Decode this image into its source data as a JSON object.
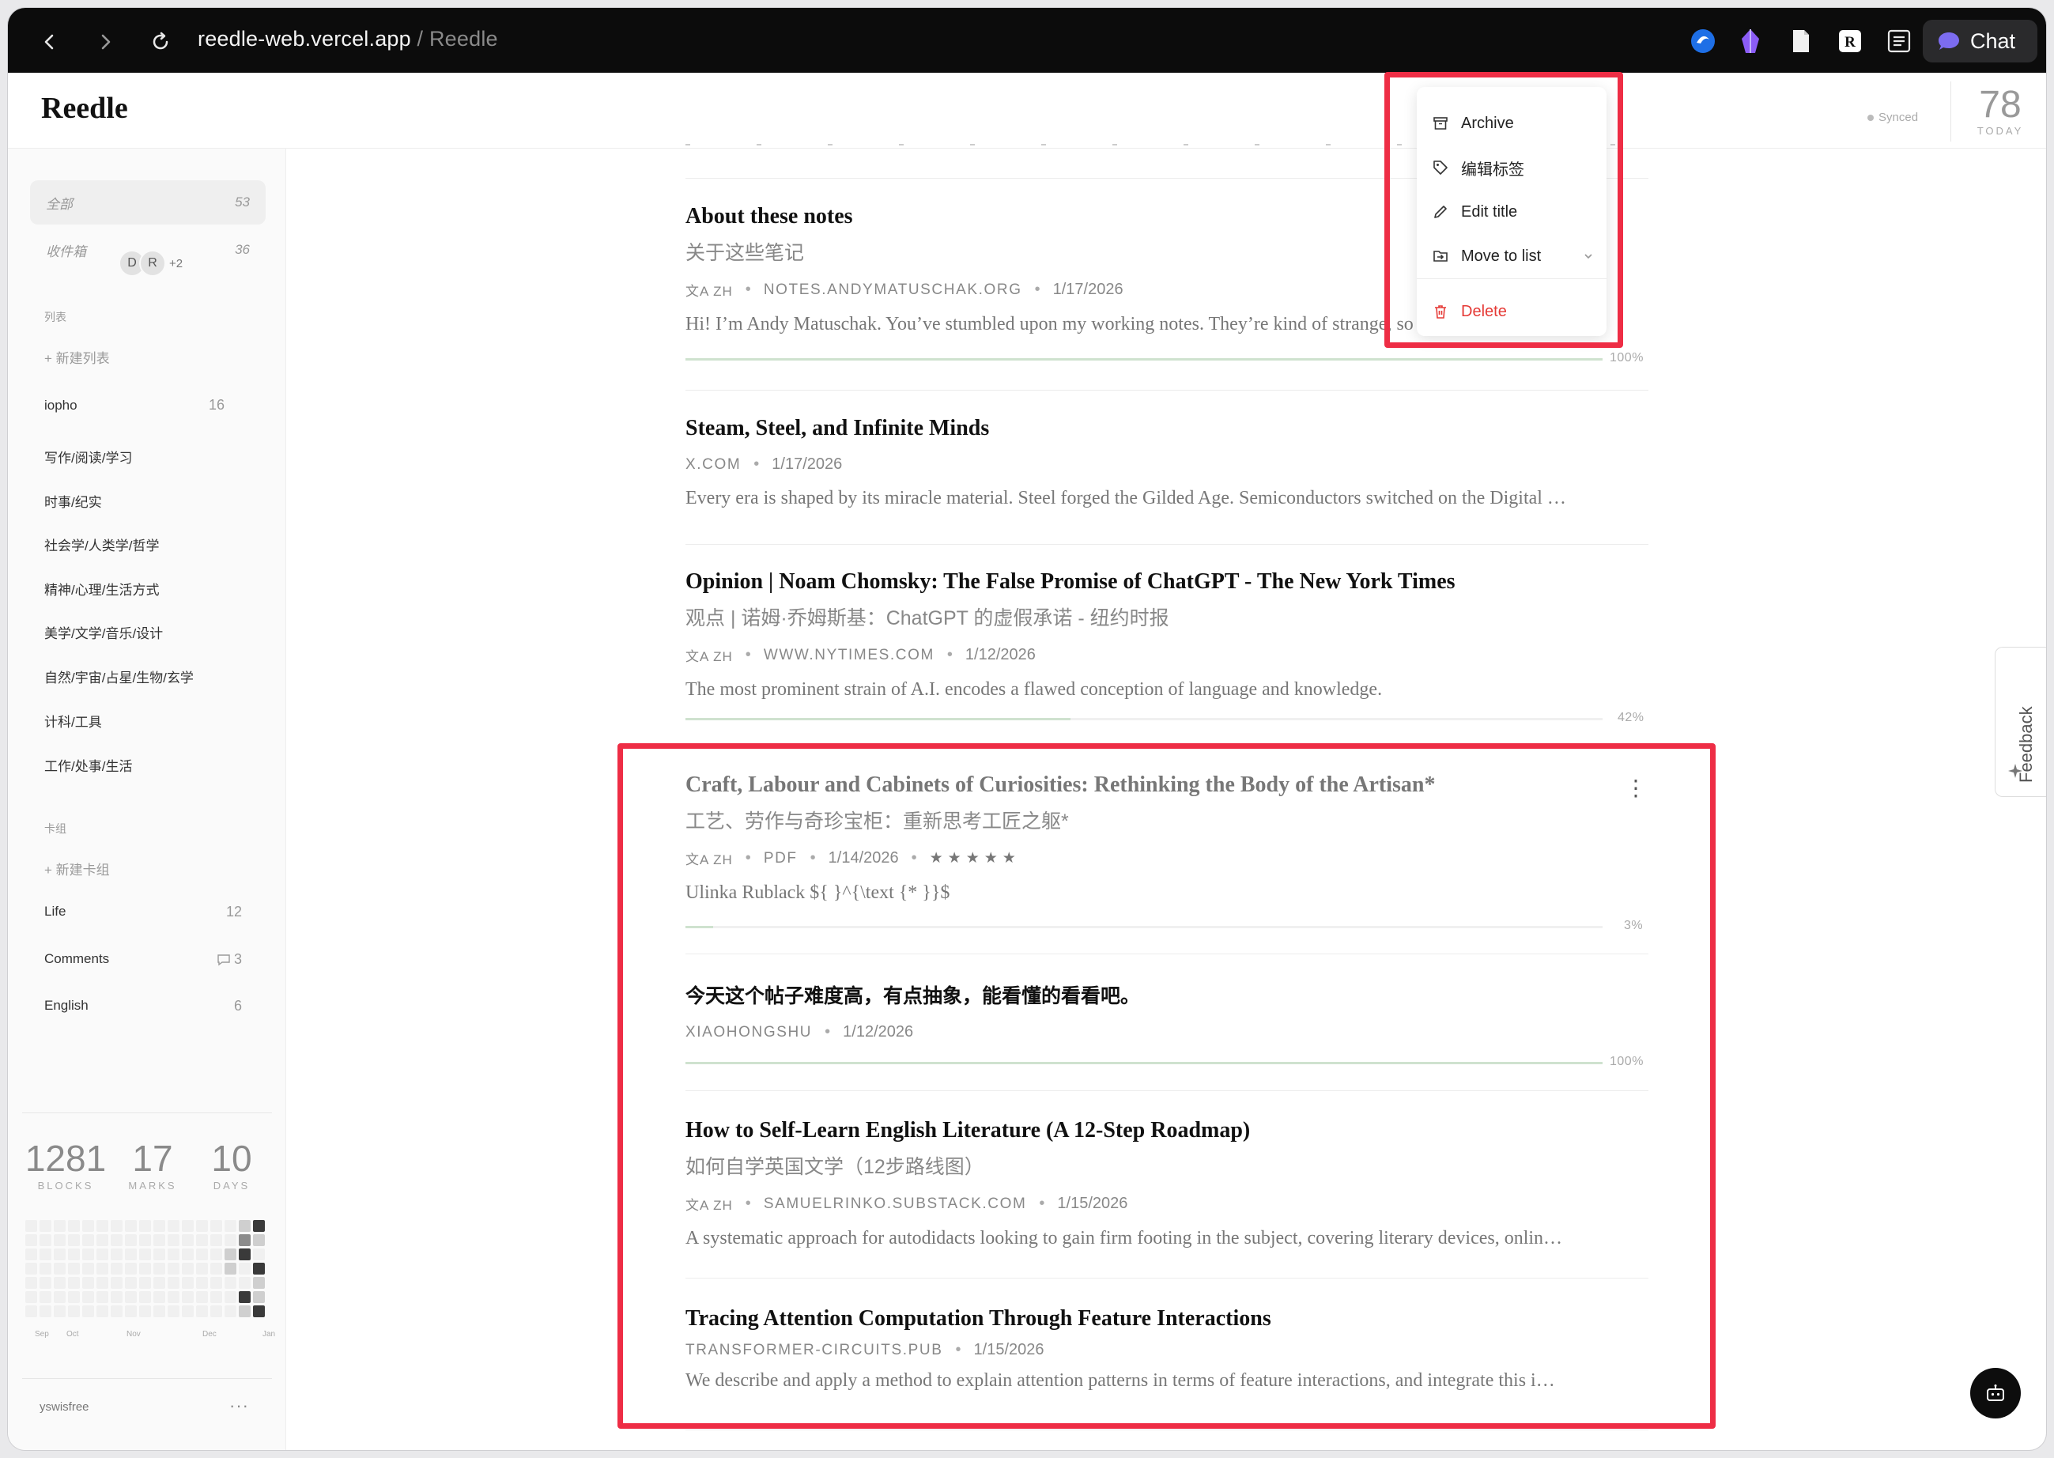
{
  "browser": {
    "url_host": "reedle-web.vercel.app",
    "url_sep": " / ",
    "page_title": "Reedle",
    "chat_label": "Chat"
  },
  "header": {
    "logo": "Reedle",
    "synced": "Synced",
    "today_count": "78",
    "today_label": "TODAY"
  },
  "sidebar": {
    "nav": [
      {
        "label": "全部",
        "count": "53"
      },
      {
        "label": "收件箱",
        "count": "36"
      }
    ],
    "lists_title": "列表",
    "new_list": "+ 新建列表",
    "shared_list": {
      "name": "iopho",
      "avatars": [
        "D",
        "R"
      ],
      "more": "+2",
      "count": "16"
    },
    "lists": [
      "写作/阅读/学习",
      "时事/纪实",
      "社会学/人类学/哲学",
      "精神/心理/生活方式",
      "美学/文学/音乐/设计",
      "自然/宇宙/占星/生物/玄学",
      "计科/工具",
      "工作/处事/生活"
    ],
    "decks_title": "卡组",
    "new_deck": "+ 新建卡组",
    "decks": [
      {
        "name": "Life",
        "count": "12"
      },
      {
        "name": "Comments",
        "count": "3"
      },
      {
        "name": "English",
        "count": "6"
      }
    ],
    "stats": [
      {
        "value": "1281",
        "label": "BLOCKS"
      },
      {
        "value": "17",
        "label": "MARKS"
      },
      {
        "value": "10",
        "label": "DAYS"
      }
    ],
    "months": [
      "Sep",
      "Oct",
      "Nov",
      "Dec",
      "Jan"
    ],
    "username": "yswisfree",
    "more": "···"
  },
  "articles": [
    {
      "title": "About these notes",
      "subtitle": "关于这些笔记",
      "lang": "文A ZH",
      "source": "NOTES.ANDYMATUSCHAK.ORG",
      "date": "1/17/2026",
      "desc": "Hi! I’m Andy Matuschak. You’ve stumbled upon my working notes. They’re kind of strange, so some context m…",
      "progress": "100%"
    },
    {
      "title": "Steam, Steel, and Infinite Minds",
      "source": "X.COM",
      "date": "1/17/2026",
      "desc": "Every era is shaped by its miracle material. Steel forged the Gilded Age. Semiconductors switched on the Digital …"
    },
    {
      "title": "Opinion | Noam Chomsky: The False Promise of ChatGPT - The New York Times",
      "subtitle": "观点 | 诺姆·乔姆斯基：ChatGPT 的虚假承诺 - 纽约时报",
      "lang": "文A ZH",
      "source": "WWW.NYTIMES.COM",
      "date": "1/12/2026",
      "desc": "The most prominent strain of A.I. encodes a flawed conception of language and knowledge.",
      "progress": "42%"
    },
    {
      "title": "Craft, Labour and Cabinets of Curiosities: Rethinking the Body of the Artisan*",
      "subtitle": "工艺、劳作与奇珍宝柜：重新思考工匠之躯*",
      "lang": "文A ZH",
      "source": "PDF",
      "date": "1/14/2026",
      "stars": "★★★★★",
      "desc": "Ulinka Rublack ${ }^{\\text {* }}$",
      "progress": "3%"
    },
    {
      "title": "今天这个帖子难度高，有点抽象，能看懂的看看吧。",
      "source": "XIAOHONGSHU",
      "date": "1/12/2026",
      "progress": "100%"
    },
    {
      "title": "How to Self-Learn English Literature (A 12-Step Roadmap)",
      "subtitle": "如何自学英国文学（12步路线图）",
      "lang": "文A ZH",
      "source": "SAMUELRINKO.SUBSTACK.COM",
      "date": "1/15/2026",
      "desc": "A systematic approach for autodidacts looking to gain firm footing in the subject, covering literary devices, onlin…"
    },
    {
      "title": "Tracing Attention Computation Through Feature Interactions",
      "source": "TRANSFORMER-CIRCUITS.PUB",
      "date": "1/15/2026",
      "desc": "We describe and apply a method to explain attention patterns in terms of feature interactions, and integrate this i…"
    }
  ],
  "menu": {
    "archive": "Archive",
    "edit_tags": "编辑标签",
    "edit_title": "Edit title",
    "move_to_list": "Move to list",
    "delete": "Delete"
  },
  "feedback": "Feedback",
  "colors": {
    "highlight": "#ee2d45",
    "danger": "#e53935",
    "progress": "#cfe2cf"
  }
}
